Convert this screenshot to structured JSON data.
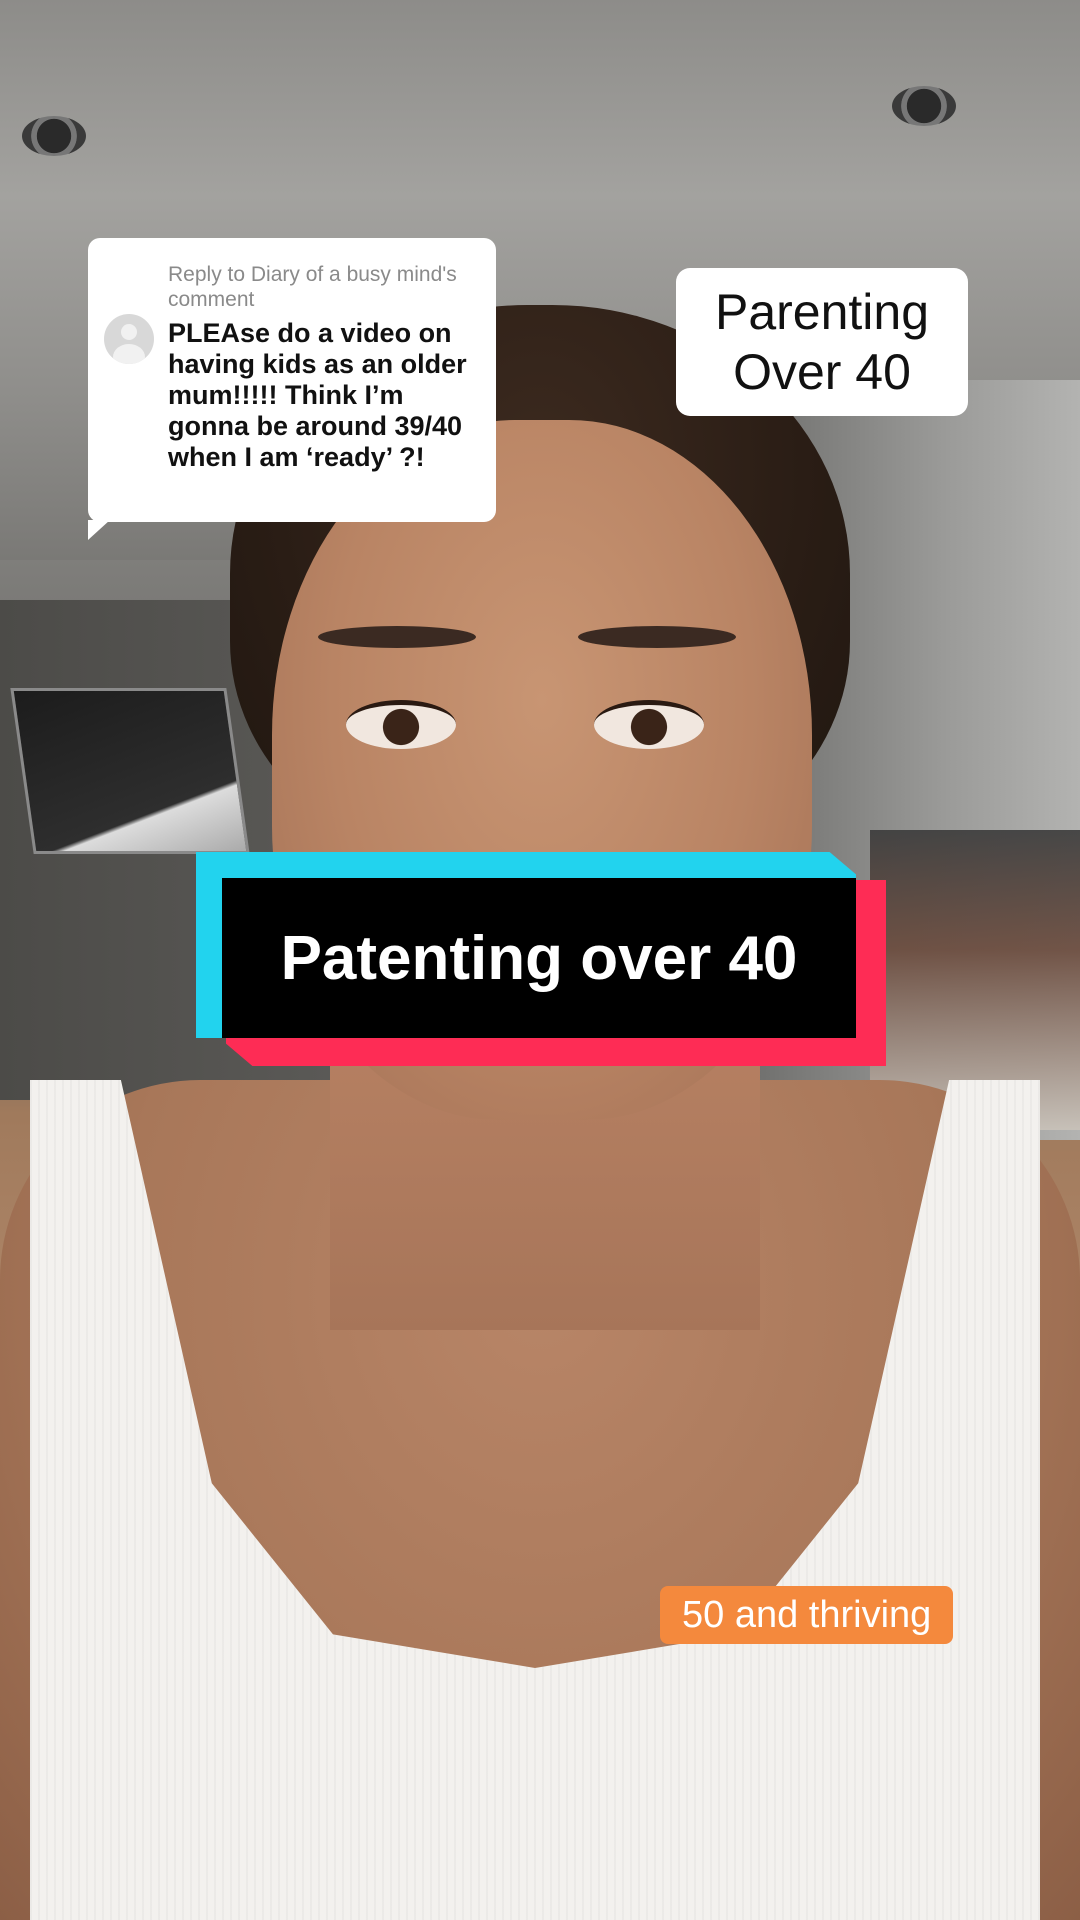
{
  "reply_card": {
    "header": "Reply to Diary of a busy mind's comment",
    "comment": "PLEAse do a video on having kids as an older mum!!!!! Think I’m gonna be around 39/40 when I am ‘ready’ ?!"
  },
  "title_box": {
    "line1": "Parenting",
    "line2": "Over 40"
  },
  "caption": {
    "text": "Patenting over 40"
  },
  "tag": {
    "text": "50 and thriving"
  },
  "colors": {
    "caption_cyan": "#22d3ee",
    "caption_red": "#fe2c55",
    "tag_orange": "#f4893d"
  }
}
